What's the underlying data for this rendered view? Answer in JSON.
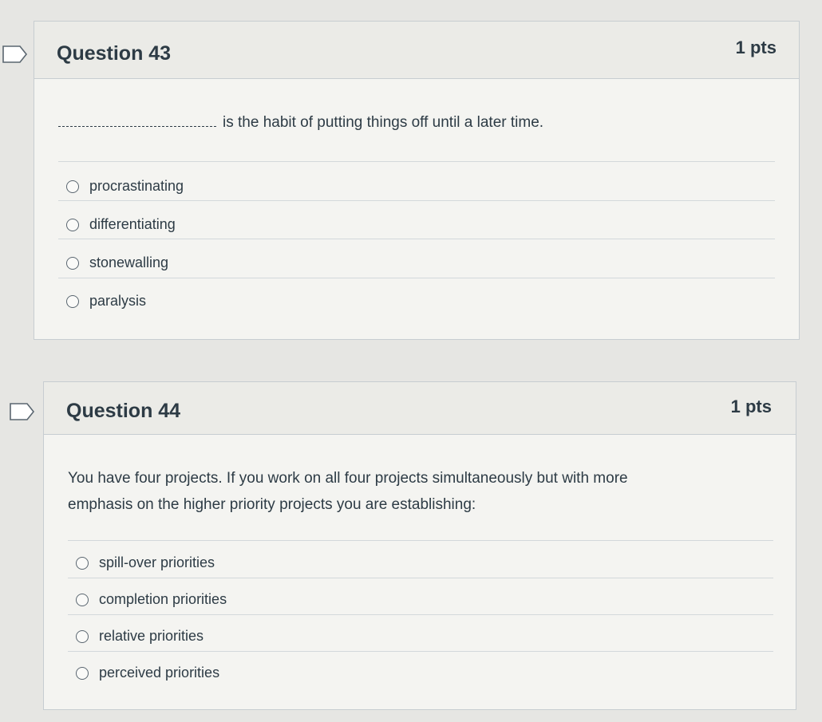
{
  "questions": [
    {
      "title": "Question 43",
      "points": "1 pts",
      "blank_text": "is the habit of putting things off until a later time.",
      "answers": [
        {
          "label": "procrastinating"
        },
        {
          "label": "differentiating"
        },
        {
          "label": "stonewalling"
        },
        {
          "label": "paralysis"
        }
      ]
    },
    {
      "title": "Question 44",
      "points": "1 pts",
      "prompt_line1": "You have four projects. If you work on all four projects simultaneously but with more",
      "prompt_line2": "emphasis on the higher priority projects you are establishing:",
      "answers": [
        {
          "label": "spill-over priorities"
        },
        {
          "label": "completion priorities"
        },
        {
          "label": "relative priorities"
        },
        {
          "label": "perceived priorities"
        }
      ]
    }
  ]
}
